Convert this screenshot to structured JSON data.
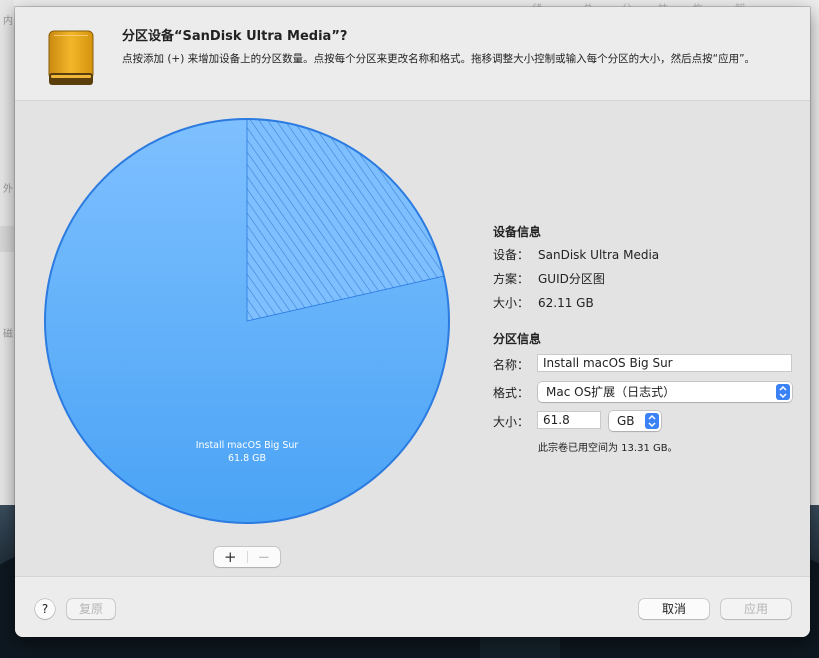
{
  "background": {
    "side_glyphs": [
      "内",
      "外",
      "磁"
    ],
    "top_texts": [
      "储",
      "总",
      "分",
      "抹",
      "恢",
      "卸"
    ]
  },
  "sheet": {
    "title": "分区设备“SanDisk Ultra Media”?",
    "description": "点按添加 (+) 来增加设备上的分区数量。点按每个分区来更改名称和格式。拖移调整大小控制或输入每个分区的大小，然后点按“应用”。"
  },
  "pie": {
    "partition_label": "Install macOS Big Sur",
    "partition_size": "61.8 GB",
    "used_fraction": 0.2143,
    "colors": {
      "fill": "#4aa3f5",
      "fill_light": "#7ec0ff",
      "border": "#2b7be0",
      "used_hatch": "#3d7fd1"
    }
  },
  "seg_control": {
    "add_label": "+",
    "remove_label": "−"
  },
  "device_info": {
    "title": "设备信息",
    "device_key": "设备：",
    "device_value": "SanDisk Ultra Media",
    "scheme_key": "方案：",
    "scheme_value": "GUID分区图",
    "size_key": "大小：",
    "size_value": "62.11 GB"
  },
  "partition_info": {
    "title": "分区信息",
    "name_key": "名称：",
    "name_value": "Install macOS Big Sur",
    "format_key": "格式：",
    "format_value": "Mac OS扩展（日志式）",
    "size_key": "大小：",
    "size_value": "61.8",
    "unit_value": "GB",
    "used_note": "此宗卷已用空间为 13.31 GB。"
  },
  "footer": {
    "help_label": "?",
    "revert_label": "复原",
    "cancel_label": "取消",
    "apply_label": "应用"
  },
  "accent": "#3b82f6"
}
